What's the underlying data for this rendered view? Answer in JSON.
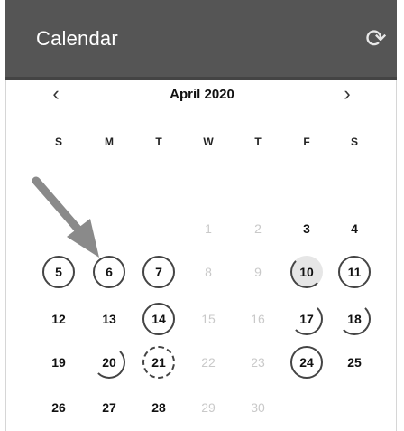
{
  "header": {
    "title": "Calendar",
    "refresh_icon": "refresh-icon"
  },
  "nav": {
    "prev": "‹",
    "next": "›",
    "month": "April 2020"
  },
  "weekdays": [
    "S",
    "M",
    "T",
    "W",
    "T",
    "F",
    "S"
  ],
  "days": [
    {
      "label": "1",
      "style": "faded"
    },
    {
      "label": "2",
      "style": "faded"
    },
    {
      "label": "3",
      "style": "normal"
    },
    {
      "label": "4",
      "style": "normal"
    },
    {
      "label": "5",
      "style": "full"
    },
    {
      "label": "6",
      "style": "full"
    },
    {
      "label": "7",
      "style": "full"
    },
    {
      "label": "8",
      "style": "faded"
    },
    {
      "label": "9",
      "style": "faded"
    },
    {
      "label": "10",
      "style": "quarter-selected"
    },
    {
      "label": "11",
      "style": "full"
    },
    {
      "label": "12",
      "style": "normal"
    },
    {
      "label": "13",
      "style": "normal"
    },
    {
      "label": "14",
      "style": "full"
    },
    {
      "label": "15",
      "style": "faded"
    },
    {
      "label": "16",
      "style": "faded"
    },
    {
      "label": "17",
      "style": "half"
    },
    {
      "label": "18",
      "style": "half"
    },
    {
      "label": "19",
      "style": "normal"
    },
    {
      "label": "20",
      "style": "half"
    },
    {
      "label": "21",
      "style": "dashed"
    },
    {
      "label": "22",
      "style": "faded"
    },
    {
      "label": "23",
      "style": "faded"
    },
    {
      "label": "24",
      "style": "full"
    },
    {
      "label": "25",
      "style": "normal"
    },
    {
      "label": "26",
      "style": "normal"
    },
    {
      "label": "27",
      "style": "normal"
    },
    {
      "label": "28",
      "style": "normal"
    },
    {
      "label": "29",
      "style": "faded"
    },
    {
      "label": "30",
      "style": "faded"
    }
  ],
  "colors": {
    "header_bg": "#555555",
    "ring": "#444444",
    "arrow": "#8a8a8a"
  }
}
